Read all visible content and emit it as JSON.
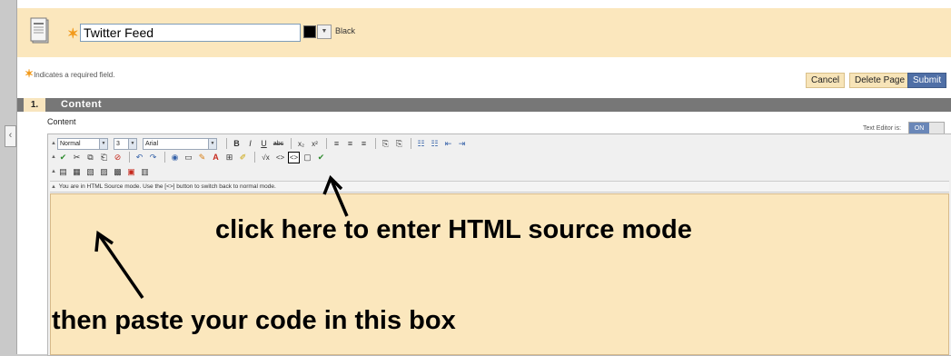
{
  "page": {
    "title_field_value": "Twitter Feed",
    "color_label": "Black"
  },
  "required_note": "Indicates a required field.",
  "buttons": {
    "cancel": "Cancel",
    "delete_page": "Delete Page",
    "submit": "Submit"
  },
  "section": {
    "number": "1.",
    "title": "Content",
    "field_label": "Content"
  },
  "text_editor": {
    "label": "Text Editor is:",
    "state": "ON"
  },
  "toolbar": {
    "paragraph_format": "Normal",
    "font_size": "3",
    "font_family": "Arial",
    "row1_buttons": [
      "B",
      "I",
      "U",
      "abc",
      "x₂",
      "x²",
      "≡",
      "≡",
      "≡",
      "⎘",
      "⎘",
      "☷",
      "☷",
      "⇤",
      "⇥"
    ],
    "row2_buttons": [
      "✔",
      "✂",
      "⧉",
      "⎗",
      "⊘",
      "↶",
      "↷",
      "◉",
      "▭",
      "✎",
      "A",
      "⊞",
      "✐",
      "√x",
      "<>",
      "<>",
      "▢",
      "✔"
    ],
    "row3_buttons": [
      "▤",
      "▦",
      "▧",
      "▨",
      "▩",
      "▣",
      "▥"
    ]
  },
  "notice": "You are in HTML Source mode. Use the [<>] button to switch back to normal mode.",
  "annotations": {
    "instruction_1": "click here to enter HTML source mode",
    "instruction_2": "then paste your code in this box"
  },
  "colors": {
    "header_background": "#fbe7bd",
    "section_bar": "#777777",
    "submit_button": "#4f6fa6",
    "required_star": "#f29a1b"
  }
}
